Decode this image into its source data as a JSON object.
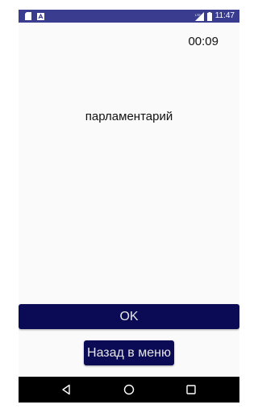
{
  "status_bar": {
    "time": "11:47",
    "network_label": "LTE",
    "left_icons": [
      "sd-card-icon",
      "notification-icon"
    ],
    "right_icons": [
      "signal-icon",
      "battery-icon"
    ]
  },
  "game": {
    "timer": "00:09",
    "word": "парламентарий"
  },
  "buttons": {
    "ok_label": "OK",
    "menu_label": "Назад в меню"
  },
  "nav_bar": {
    "items": [
      "back-icon",
      "home-icon",
      "recents-icon"
    ]
  },
  "colors": {
    "status_bar": "#3a3d8f",
    "button_bg": "#0a0a55",
    "button_text": "#e6e6e6",
    "screen_bg": "#fafafa",
    "nav_bar": "#000000"
  }
}
